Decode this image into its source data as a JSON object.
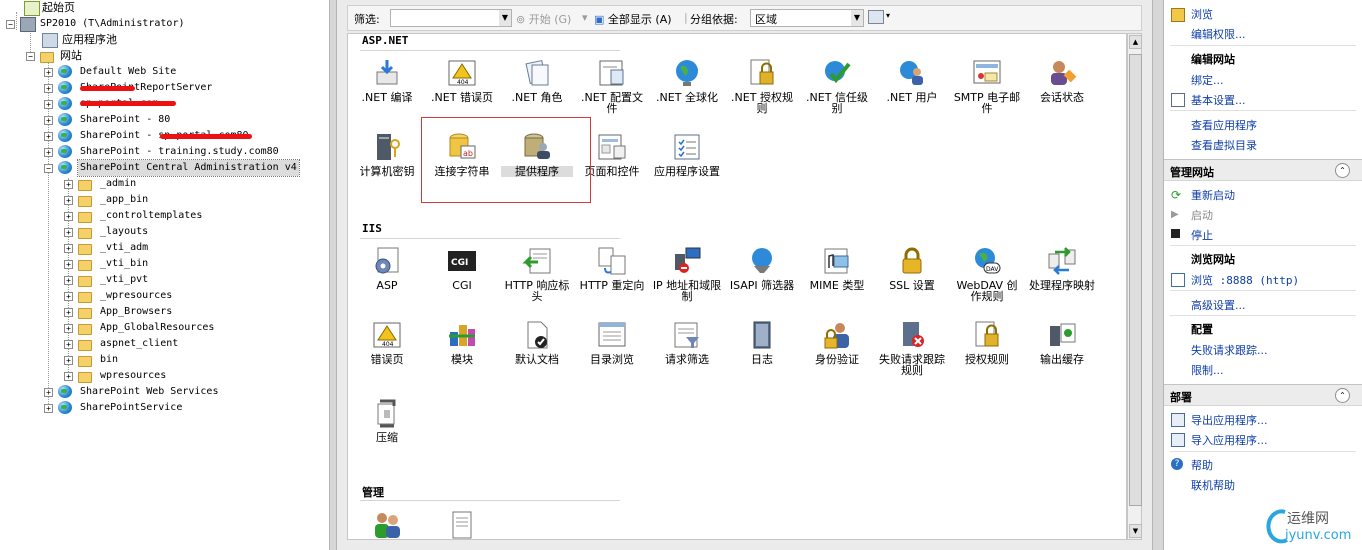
{
  "tree": {
    "start_page": "起始页",
    "server": "SP2010 (T\\Administrator)",
    "app_pools": "应用程序池",
    "sites_label": "网站",
    "sites": [
      "Default Web Site",
      "SharePointReportServer",
      "sp.portal.com",
      "SharePoint - 80",
      "SharePoint - sp.portal.com80",
      "SharePoint - training.study.com80",
      "SharePoint Central Administration v4"
    ],
    "children": [
      "_admin",
      "_app_bin",
      "_controltemplates",
      "_layouts",
      "_vti_adm",
      "_vti_bin",
      "_vti_pvt",
      "_wpresources",
      "App_Browsers",
      "App_GlobalResources",
      "aspnet_client",
      "bin",
      "wpresources"
    ],
    "after_sites": [
      "SharePoint Web Services",
      "SharePointService"
    ]
  },
  "filterbar": {
    "filter_label": "筛选:",
    "filter_value": "",
    "start_label": "开始 (G)",
    "show_all_label": "全部显示 (A)",
    "group_label": "分组依据:",
    "group_value": "区域"
  },
  "sections": {
    "aspnet": {
      "title": "ASP.NET",
      "items": [
        ".NET 编译",
        ".NET 错误页",
        ".NET 角色",
        ".NET 配置文件",
        ".NET 全球化",
        ".NET 授权规则",
        ".NET 信任级别",
        ".NET 用户",
        "SMTP 电子邮件",
        "会话状态",
        "计算机密钥",
        "连接字符串",
        "提供程序",
        "页面和控件",
        "应用程序设置"
      ]
    },
    "iis": {
      "title": "IIS",
      "items": [
        "ASP",
        "CGI",
        "HTTP 响应标头",
        "HTTP 重定向",
        "IP 地址和域限制",
        "ISAPI 筛选器",
        "MIME 类型",
        "SSL 设置",
        "WebDAV 创作规则",
        "处理程序映射",
        "错误页",
        "模块",
        "默认文档",
        "目录浏览",
        "请求筛选",
        "日志",
        "身份验证",
        "失败请求跟踪规则",
        "授权规则",
        "输出缓存",
        "压缩"
      ]
    },
    "manage": {
      "title": "管理"
    }
  },
  "actions": {
    "top": [
      "浏览",
      "编辑权限..."
    ],
    "edit_site": {
      "title": "编辑网站",
      "items": [
        "绑定...",
        "基本设置...",
        "查看应用程序",
        "查看虚拟目录"
      ]
    },
    "manage_site": {
      "title": "管理网站",
      "items": [
        "重新启动",
        "启动",
        "停止"
      ],
      "browse_title": "浏览网站",
      "browse_item": "浏览 :8888 (http)",
      "advanced": "高级设置...",
      "config_title": "配置",
      "config_items": [
        "失败请求跟踪...",
        "限制..."
      ]
    },
    "deploy": {
      "title": "部署",
      "items": [
        "导出应用程序...",
        "导入应用程序..."
      ]
    },
    "help": [
      "帮助",
      "联机帮助"
    ]
  },
  "watermark": {
    "text": "运维网",
    "url_text": "iyunv.com"
  },
  "colors": {
    "link": "#0e3ea8",
    "highlight_box": "#d23a3a",
    "redaction": "#ee1111"
  }
}
